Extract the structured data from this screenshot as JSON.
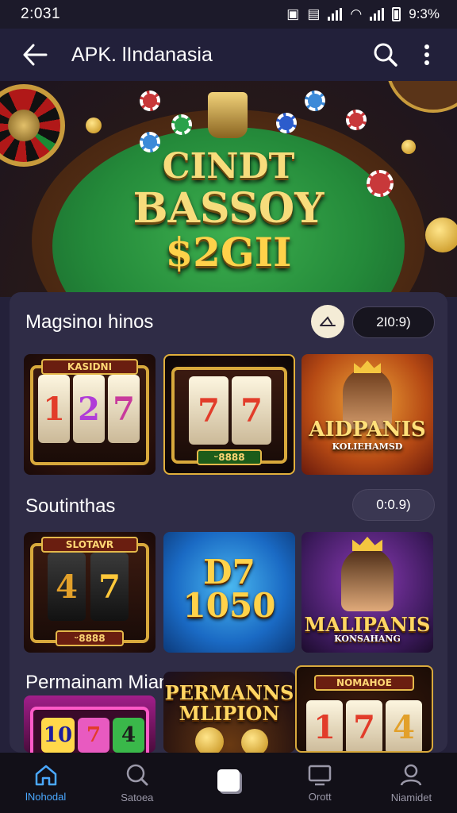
{
  "status_bar": {
    "time": "2:031",
    "indicators": "ꟾ ꟾ",
    "battery": "9:3%"
  },
  "app_bar": {
    "title": "APK. lIndanasia",
    "back_icon": "arrow-left-icon",
    "search_icon": "search-icon",
    "menu_icon": "more-vertical-icon"
  },
  "hero": {
    "line1": "CINDT",
    "line2": "BASSOY",
    "line3": "$2GII"
  },
  "sections": [
    {
      "title": "Magsinoı hinos",
      "pill": "2I0:9)",
      "cards": [
        {
          "banner": "KASIDNI",
          "reels": [
            "1",
            "2",
            "7"
          ]
        },
        {
          "reels": [
            "7",
            "7"
          ],
          "plate": "ᵕ8888"
        },
        {
          "title": "AIDPANIS",
          "subtitle": "KOLIEHAMSD"
        }
      ]
    },
    {
      "title": "Soutinthas",
      "pill": "0:0.9)",
      "cards": [
        {
          "banner": "SLOTAVR",
          "reels": [
            "4",
            "7"
          ],
          "plate": "ᵕ8888"
        },
        {
          "title": "D7",
          "subtitle": "1050"
        },
        {
          "title": "MALIPANIS",
          "subtitle": "KONSAHANG"
        }
      ]
    },
    {
      "title": "Permainam Miaman",
      "cards": [
        {
          "reels": [
            "10",
            "7",
            "4"
          ]
        },
        {
          "title": "PERMANNS",
          "subtitle": "MLIPION"
        },
        {
          "banner": "NOMAHOE",
          "reels": [
            "1",
            "7",
            "4"
          ]
        }
      ]
    }
  ],
  "bottom_nav": [
    {
      "label": "lNohodal",
      "icon": "home-icon",
      "active": true
    },
    {
      "label": "Satoea",
      "icon": "search-icon",
      "active": false
    },
    {
      "label": "",
      "icon": "square-icon",
      "active": false
    },
    {
      "label": "Orott",
      "icon": "monitor-icon",
      "active": false
    },
    {
      "label": "Niamidet",
      "icon": "user-icon",
      "active": false
    }
  ]
}
